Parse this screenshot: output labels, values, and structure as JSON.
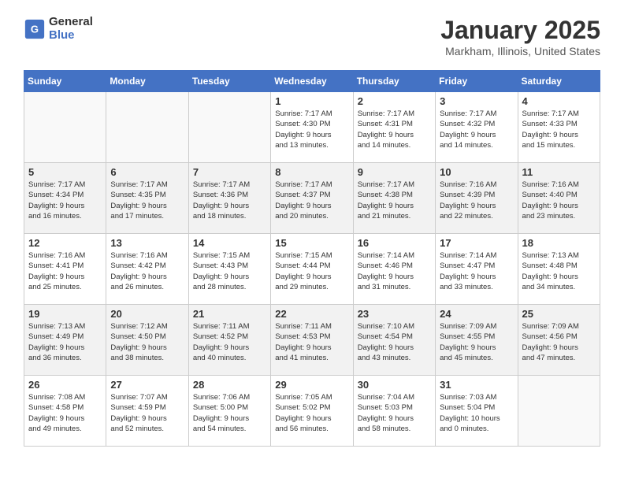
{
  "logo": {
    "general": "General",
    "blue": "Blue"
  },
  "title": "January 2025",
  "location": "Markham, Illinois, United States",
  "days_of_week": [
    "Sunday",
    "Monday",
    "Tuesday",
    "Wednesday",
    "Thursday",
    "Friday",
    "Saturday"
  ],
  "weeks": [
    [
      {
        "day": null,
        "info": null
      },
      {
        "day": null,
        "info": null
      },
      {
        "day": null,
        "info": null
      },
      {
        "day": "1",
        "info": "Sunrise: 7:17 AM\nSunset: 4:30 PM\nDaylight: 9 hours\nand 13 minutes."
      },
      {
        "day": "2",
        "info": "Sunrise: 7:17 AM\nSunset: 4:31 PM\nDaylight: 9 hours\nand 14 minutes."
      },
      {
        "day": "3",
        "info": "Sunrise: 7:17 AM\nSunset: 4:32 PM\nDaylight: 9 hours\nand 14 minutes."
      },
      {
        "day": "4",
        "info": "Sunrise: 7:17 AM\nSunset: 4:33 PM\nDaylight: 9 hours\nand 15 minutes."
      }
    ],
    [
      {
        "day": "5",
        "info": "Sunrise: 7:17 AM\nSunset: 4:34 PM\nDaylight: 9 hours\nand 16 minutes."
      },
      {
        "day": "6",
        "info": "Sunrise: 7:17 AM\nSunset: 4:35 PM\nDaylight: 9 hours\nand 17 minutes."
      },
      {
        "day": "7",
        "info": "Sunrise: 7:17 AM\nSunset: 4:36 PM\nDaylight: 9 hours\nand 18 minutes."
      },
      {
        "day": "8",
        "info": "Sunrise: 7:17 AM\nSunset: 4:37 PM\nDaylight: 9 hours\nand 20 minutes."
      },
      {
        "day": "9",
        "info": "Sunrise: 7:17 AM\nSunset: 4:38 PM\nDaylight: 9 hours\nand 21 minutes."
      },
      {
        "day": "10",
        "info": "Sunrise: 7:16 AM\nSunset: 4:39 PM\nDaylight: 9 hours\nand 22 minutes."
      },
      {
        "day": "11",
        "info": "Sunrise: 7:16 AM\nSunset: 4:40 PM\nDaylight: 9 hours\nand 23 minutes."
      }
    ],
    [
      {
        "day": "12",
        "info": "Sunrise: 7:16 AM\nSunset: 4:41 PM\nDaylight: 9 hours\nand 25 minutes."
      },
      {
        "day": "13",
        "info": "Sunrise: 7:16 AM\nSunset: 4:42 PM\nDaylight: 9 hours\nand 26 minutes."
      },
      {
        "day": "14",
        "info": "Sunrise: 7:15 AM\nSunset: 4:43 PM\nDaylight: 9 hours\nand 28 minutes."
      },
      {
        "day": "15",
        "info": "Sunrise: 7:15 AM\nSunset: 4:44 PM\nDaylight: 9 hours\nand 29 minutes."
      },
      {
        "day": "16",
        "info": "Sunrise: 7:14 AM\nSunset: 4:46 PM\nDaylight: 9 hours\nand 31 minutes."
      },
      {
        "day": "17",
        "info": "Sunrise: 7:14 AM\nSunset: 4:47 PM\nDaylight: 9 hours\nand 33 minutes."
      },
      {
        "day": "18",
        "info": "Sunrise: 7:13 AM\nSunset: 4:48 PM\nDaylight: 9 hours\nand 34 minutes."
      }
    ],
    [
      {
        "day": "19",
        "info": "Sunrise: 7:13 AM\nSunset: 4:49 PM\nDaylight: 9 hours\nand 36 minutes."
      },
      {
        "day": "20",
        "info": "Sunrise: 7:12 AM\nSunset: 4:50 PM\nDaylight: 9 hours\nand 38 minutes."
      },
      {
        "day": "21",
        "info": "Sunrise: 7:11 AM\nSunset: 4:52 PM\nDaylight: 9 hours\nand 40 minutes."
      },
      {
        "day": "22",
        "info": "Sunrise: 7:11 AM\nSunset: 4:53 PM\nDaylight: 9 hours\nand 41 minutes."
      },
      {
        "day": "23",
        "info": "Sunrise: 7:10 AM\nSunset: 4:54 PM\nDaylight: 9 hours\nand 43 minutes."
      },
      {
        "day": "24",
        "info": "Sunrise: 7:09 AM\nSunset: 4:55 PM\nDaylight: 9 hours\nand 45 minutes."
      },
      {
        "day": "25",
        "info": "Sunrise: 7:09 AM\nSunset: 4:56 PM\nDaylight: 9 hours\nand 47 minutes."
      }
    ],
    [
      {
        "day": "26",
        "info": "Sunrise: 7:08 AM\nSunset: 4:58 PM\nDaylight: 9 hours\nand 49 minutes."
      },
      {
        "day": "27",
        "info": "Sunrise: 7:07 AM\nSunset: 4:59 PM\nDaylight: 9 hours\nand 52 minutes."
      },
      {
        "day": "28",
        "info": "Sunrise: 7:06 AM\nSunset: 5:00 PM\nDaylight: 9 hours\nand 54 minutes."
      },
      {
        "day": "29",
        "info": "Sunrise: 7:05 AM\nSunset: 5:02 PM\nDaylight: 9 hours\nand 56 minutes."
      },
      {
        "day": "30",
        "info": "Sunrise: 7:04 AM\nSunset: 5:03 PM\nDaylight: 9 hours\nand 58 minutes."
      },
      {
        "day": "31",
        "info": "Sunrise: 7:03 AM\nSunset: 5:04 PM\nDaylight: 10 hours\nand 0 minutes."
      },
      {
        "day": null,
        "info": null
      }
    ]
  ]
}
